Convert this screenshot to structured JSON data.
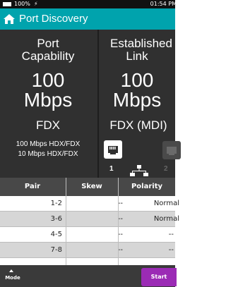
{
  "status": {
    "battery": "100%",
    "charge_icon": "⚡",
    "time": "01:54 PM"
  },
  "header": {
    "title": "Port Discovery",
    "icon": "home-icon",
    "color": "#00a3ad"
  },
  "port_capability": {
    "label_line1": "Port",
    "label_line2": "Capability",
    "speed_value": "100",
    "speed_unit": "Mbps",
    "duplex": "FDX",
    "capabilities": [
      "100 Mbps HDX/FDX",
      "10 Mbps HDX/FDX"
    ]
  },
  "established_link": {
    "label_line1": "Established",
    "label_line2": "Link",
    "speed_value": "100",
    "speed_unit": "Mbps",
    "duplex": "FDX (MDI)"
  },
  "ports": [
    {
      "number": "1",
      "icon": "ethernet-port-icon",
      "active": true
    },
    {
      "number": "2",
      "icon": "ethernet-port-icon",
      "active": false
    }
  ],
  "table": {
    "headers": [
      "Pair",
      "Skew",
      "Polarity"
    ],
    "rows": [
      {
        "pair": "1-2",
        "skew": "--",
        "polarity": "Normal"
      },
      {
        "pair": "3-6",
        "skew": "--",
        "polarity": "Normal"
      },
      {
        "pair": "4-5",
        "skew": "--",
        "polarity": "--"
      },
      {
        "pair": "7-8",
        "skew": "--",
        "polarity": "--"
      }
    ]
  },
  "footer": {
    "mode_label": "Mode",
    "start_label": "Start",
    "start_color": "#9b2bb5"
  }
}
